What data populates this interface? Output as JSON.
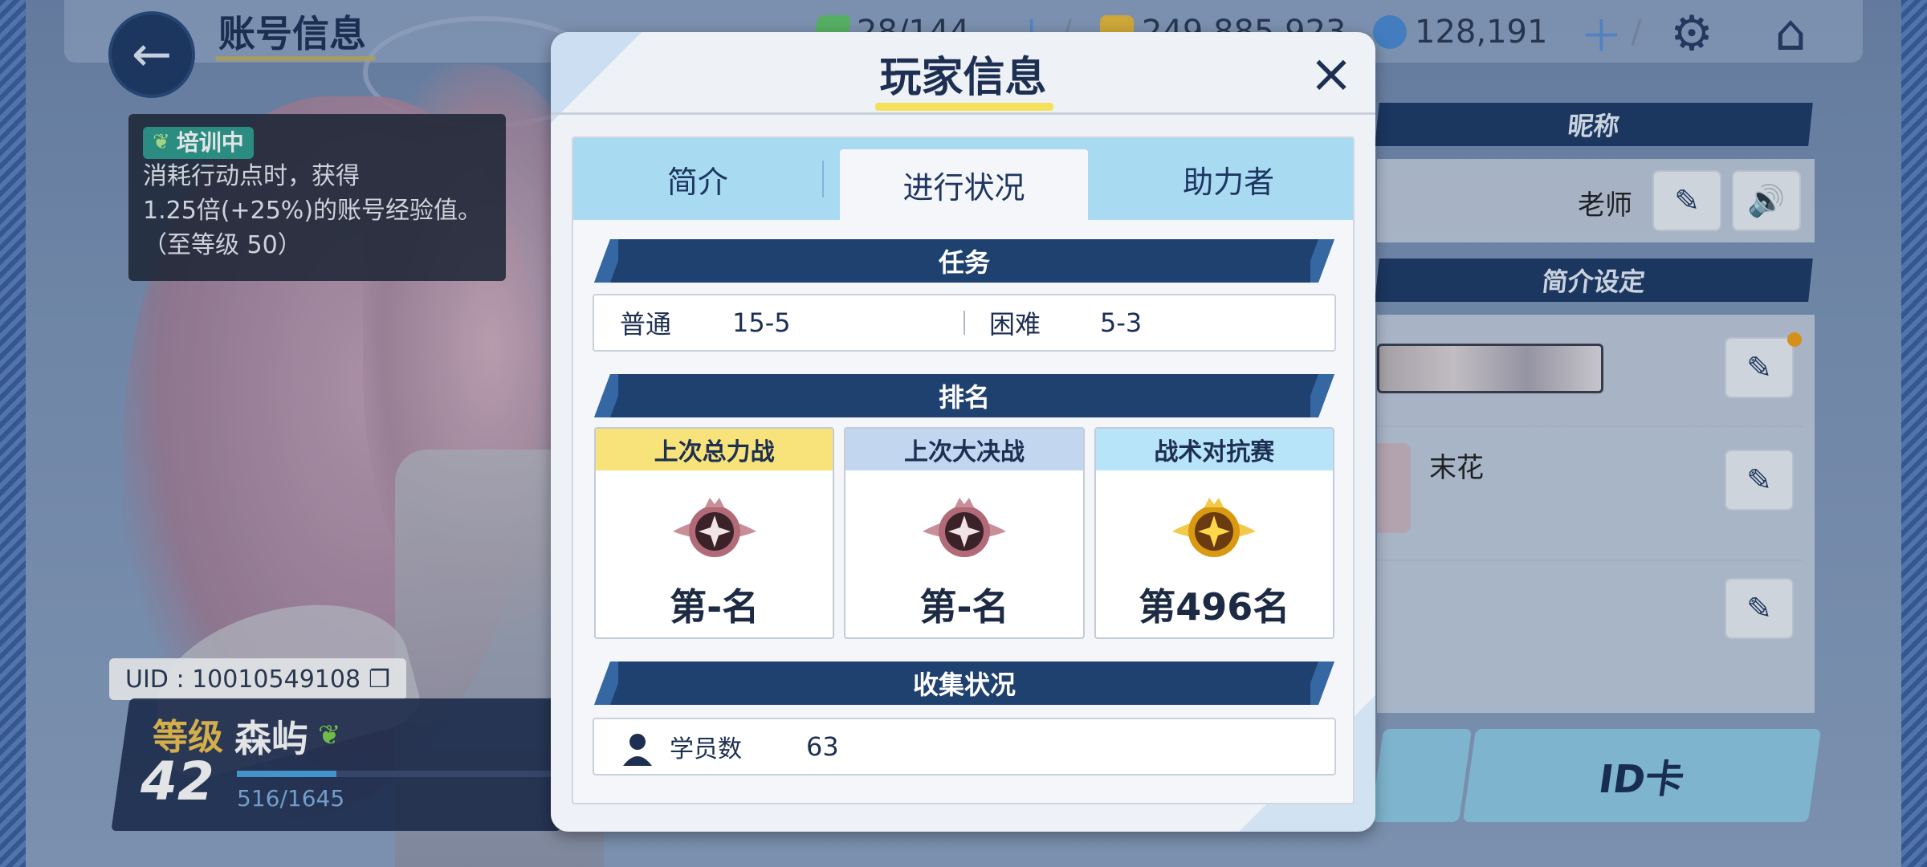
{
  "header": {
    "title": "账号信息",
    "ap": "28/144",
    "credits": "249,885,923",
    "gems": "128,191",
    "plus": "＋",
    "separator": "/"
  },
  "training": {
    "badge": "培训中",
    "line1": "消耗行动点时，获得",
    "line2": "1.25倍(+25%)的账号经验值。",
    "line3": "（至等级 50）"
  },
  "player": {
    "uid": "UID : 10010549108",
    "level_label": "等级",
    "level": "42",
    "name": "森屿",
    "exp": "516/1645",
    "exp_progress": 0.31
  },
  "right_panel": {
    "nickname_header": "昵称",
    "nickname": "老师",
    "profile_header": "简介设定",
    "sticker_name": "末花",
    "id_card": "ID卡"
  },
  "modal": {
    "title": "玩家信息",
    "close": "×",
    "tabs": [
      "简介",
      "进行状况",
      "助力者"
    ],
    "active_tab": 1,
    "mission": {
      "header": "任务",
      "normal_label": "普通",
      "normal_value": "15-5",
      "hard_label": "困难",
      "hard_value": "5-3"
    },
    "ranking": {
      "header": "排名",
      "cards": [
        {
          "title": "上次总力战",
          "rank": "第-名",
          "medal": "silver"
        },
        {
          "title": "上次大决战",
          "rank": "第-名",
          "medal": "silver"
        },
        {
          "title": "战术对抗赛",
          "rank": "第496名",
          "medal": "gold"
        }
      ]
    },
    "collection": {
      "header": "收集状况",
      "students_label": "学员数",
      "students_value": "63"
    }
  },
  "colors": {
    "navy": "#1f4170",
    "tab_bg": "#a8dbf2",
    "accent_yellow": "#f4e05a",
    "medal_silver": "#8a5a66",
    "medal_gold": "#e6b020"
  }
}
